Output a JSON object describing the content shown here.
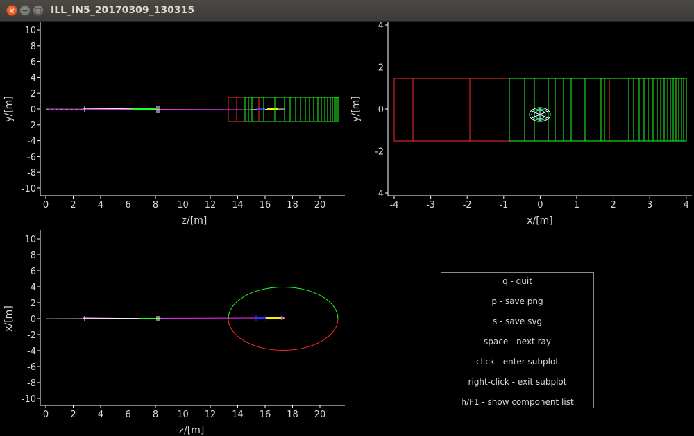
{
  "window": {
    "title": "ILL_IN5_20170309_130315",
    "close_label": "×",
    "minimize_label": "−",
    "maximize_label": "□"
  },
  "plots": {
    "zy": {
      "xlabel": "z/[m]",
      "ylabel": "y/[m]",
      "xticks": [
        "0",
        "2",
        "4",
        "6",
        "8",
        "10",
        "12",
        "14",
        "16",
        "18",
        "20"
      ],
      "yticks": [
        "10",
        "8",
        "6",
        "4",
        "2",
        "0",
        "-2",
        "-4",
        "-6",
        "-8",
        "-10"
      ]
    },
    "xy": {
      "xlabel": "x/[m]",
      "ylabel": "y/[m]",
      "xticks": [
        "-4",
        "-3",
        "-2",
        "-1",
        "0",
        "1",
        "2",
        "3",
        "4"
      ],
      "yticks": [
        "4",
        "2",
        "0",
        "-2",
        "-4"
      ]
    },
    "zx": {
      "xlabel": "z/[m]",
      "ylabel": "x/[m]",
      "xticks": [
        "0",
        "2",
        "4",
        "6",
        "8",
        "10",
        "12",
        "14",
        "16",
        "18",
        "20"
      ],
      "yticks": [
        "10",
        "8",
        "6",
        "4",
        "2",
        "0",
        "-2",
        "-4",
        "-6",
        "-8",
        "-10"
      ]
    }
  },
  "help": {
    "items": [
      "q - quit",
      "p - save png",
      "s - save svg",
      "space - next ray",
      "click - enter subplot",
      "right-click - exit subplot",
      "h/F1 - show component list"
    ]
  },
  "colors": {
    "axis": "#ffffff",
    "text": "#d8d8d8",
    "red": "#ff2a2a",
    "green": "#22ff22",
    "magenta": "#ff33ff",
    "yellow": "#ffee00",
    "blue": "#3333ff",
    "cyan": "#00ffff"
  }
}
